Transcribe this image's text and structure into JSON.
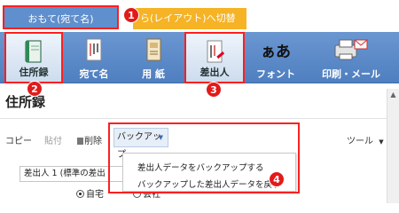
{
  "tabs": {
    "front_label": "おもて(宛て名)",
    "back_label": "ら(レイアウト)へ切替"
  },
  "ribbon": {
    "items": [
      {
        "label": "住所録",
        "icon": "address-book-icon"
      },
      {
        "label": "宛て名",
        "icon": "address-card-icon"
      },
      {
        "label": "用 紙",
        "icon": "paper-icon"
      },
      {
        "label": "差出人",
        "icon": "sender-card-icon"
      },
      {
        "label": "フォント",
        "icon": "font-icon",
        "glyph": "ぁあ"
      },
      {
        "label": "印刷・メール",
        "icon": "printer-mail-icon"
      }
    ]
  },
  "page": {
    "title": "住所録"
  },
  "commands": {
    "copy": "コピー",
    "paste": "貼付",
    "delete": "削除",
    "backup": "バックアップ",
    "tools": "ツール"
  },
  "dropdown": {
    "items": [
      "差出人データをバックアップする",
      "バックアップした差出人データを戻す"
    ]
  },
  "sender": {
    "select_value": "差出人 1 (標準の差出",
    "radio_home": "自宅",
    "radio_company": "会社"
  },
  "markers": [
    "1",
    "2",
    "3",
    "4"
  ],
  "colors": {
    "ribbon": "#5b8bc9",
    "tab_front": "#5f8fcc",
    "tab_back": "#f5b325",
    "highlight": "#ff1f1f",
    "marker": "#e21a1a"
  }
}
